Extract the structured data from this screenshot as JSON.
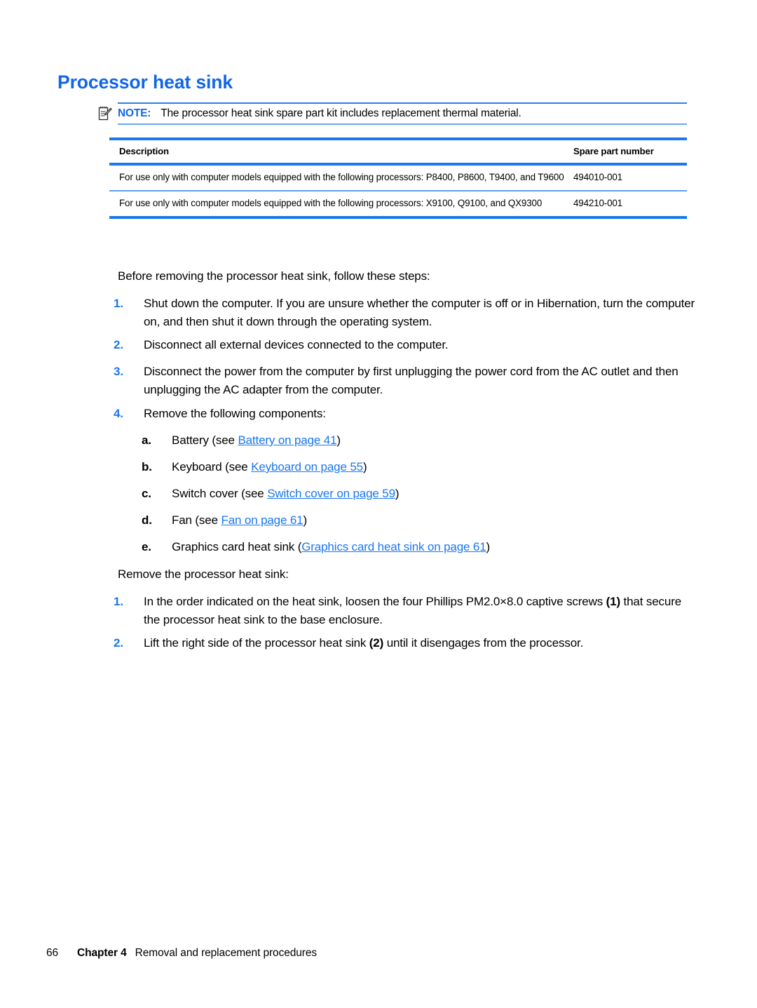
{
  "heading": "Processor heat sink",
  "note": {
    "icon": "note-pad-pencil-icon",
    "label": "NOTE:",
    "text": "The processor heat sink spare part kit includes replacement thermal material."
  },
  "table": {
    "columns": [
      "Description",
      "Spare part number"
    ],
    "rows": [
      {
        "description": "For use only with computer models equipped with the following processors: P8400, P8600, T9400, and T9600",
        "spare_part_number": "494010-001"
      },
      {
        "description": "For use only with computer models equipped with the following processors: X9100, Q9100, and QX9300",
        "spare_part_number": "494210-001"
      }
    ]
  },
  "intro_before": "Before removing the processor heat sink, follow these steps:",
  "steps_before": [
    {
      "marker": "1.",
      "text": "Shut down the computer. If you are unsure whether the computer is off or in Hibernation, turn the computer on, and then shut it down through the operating system."
    },
    {
      "marker": "2.",
      "text": "Disconnect all external devices connected to the computer."
    },
    {
      "marker": "3.",
      "text": "Disconnect the power from the computer by first unplugging the power cord from the AC outlet and then unplugging the AC adapter from the computer."
    },
    {
      "marker": "4.",
      "text": "Remove the following components:"
    }
  ],
  "components": [
    {
      "marker": "a.",
      "prefix": "Battery (see ",
      "link": "Battery on page 41",
      "suffix": ")"
    },
    {
      "marker": "b.",
      "prefix": "Keyboard (see ",
      "link": "Keyboard on page 55",
      "suffix": ")"
    },
    {
      "marker": "c.",
      "prefix": "Switch cover (see ",
      "link": "Switch cover on page 59",
      "suffix": ")"
    },
    {
      "marker": "d.",
      "prefix": "Fan (see ",
      "link": "Fan on page 61",
      "suffix": ")"
    },
    {
      "marker": "e.",
      "prefix": "Graphics card heat sink (",
      "link": "Graphics card heat sink on page 61",
      "suffix": ")"
    }
  ],
  "intro_remove": "Remove the processor heat sink:",
  "steps_remove": [
    {
      "marker": "1.",
      "part1": "In the order indicated on the heat sink, loosen the four Phillips PM2.0×8.0 captive screws ",
      "callout": "(1)",
      "part2": " that secure the processor heat sink to the base enclosure."
    },
    {
      "marker": "2.",
      "part1": "Lift the right side of the processor heat sink ",
      "callout": "(2)",
      "part2": " until it disengages from the processor."
    }
  ],
  "footer": {
    "page_number": "66",
    "chapter": "Chapter 4",
    "title": "Removal and replacement procedures"
  },
  "colors": {
    "accent_blue": "#1a77ee",
    "heading_blue": "#1166e8",
    "rule_light_blue": "#5e9df0"
  }
}
